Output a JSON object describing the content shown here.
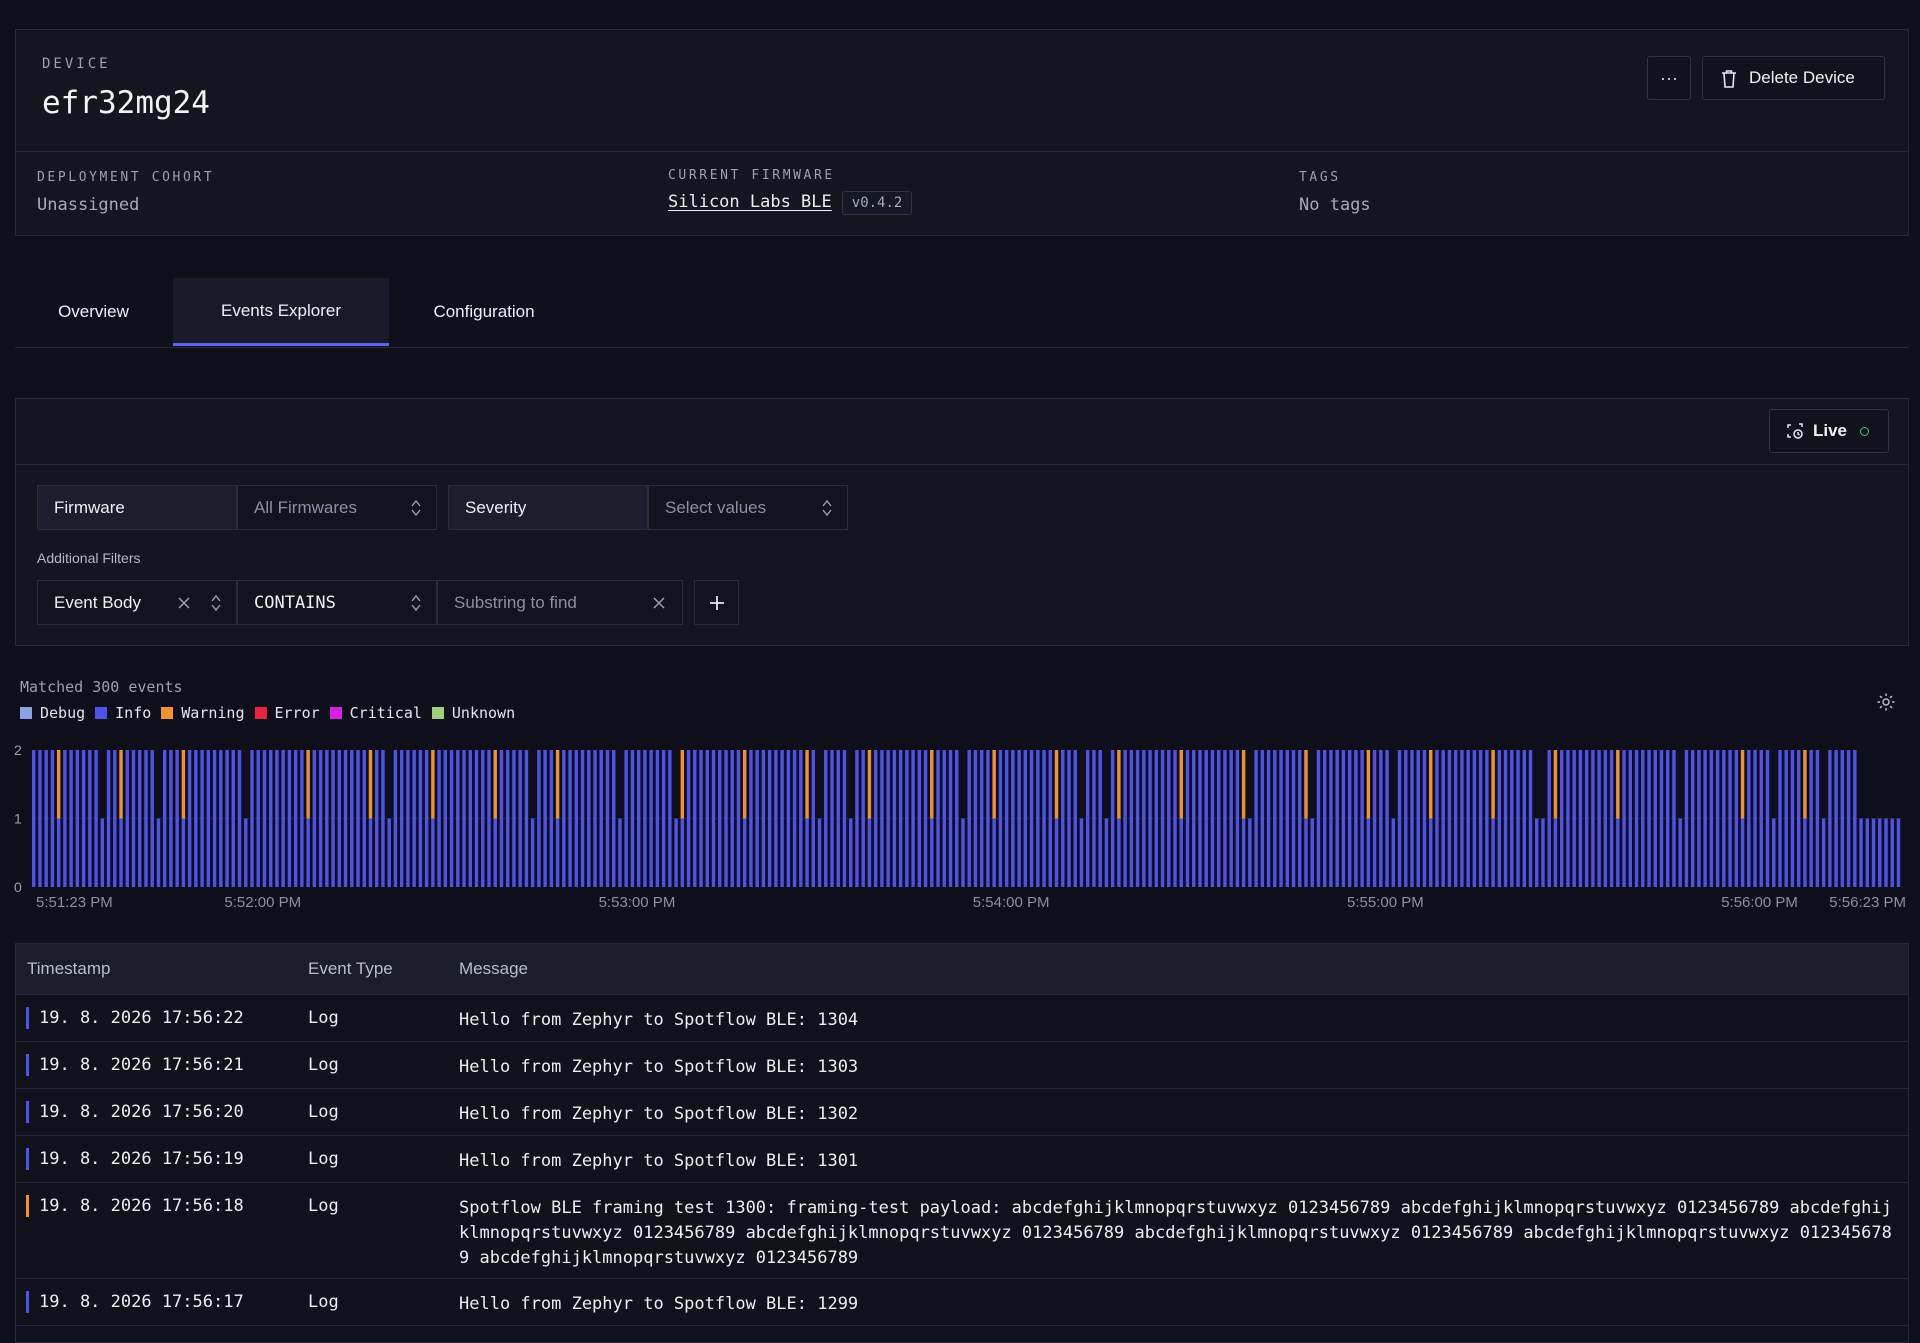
{
  "device": {
    "overline": "DEVICE",
    "name": "efr32mg24",
    "more_label": "···",
    "delete_label": "Delete Device",
    "cohort_label": "DEPLOYMENT COHORT",
    "cohort_value": "Unassigned",
    "firmware_label": "CURRENT FIRMWARE",
    "firmware_value": "Silicon Labs BLE",
    "firmware_version": "v0.4.2",
    "tags_label": "TAGS",
    "tags_value": "No tags"
  },
  "tabs": [
    {
      "label": "Overview",
      "active": false
    },
    {
      "label": "Events Explorer",
      "active": true
    },
    {
      "label": "Configuration",
      "active": false
    }
  ],
  "filters": {
    "live_label": "Live",
    "firmware_label": "Firmware",
    "firmware_value": "All Firmwares",
    "severity_label": "Severity",
    "severity_placeholder": "Select values",
    "additional_label": "Additional Filters",
    "field_value": "Event Body",
    "operator_value": "CONTAINS",
    "substring_placeholder": "Substring to find"
  },
  "summary": {
    "matched_text": "Matched 300 events"
  },
  "legend": [
    {
      "label": "Debug",
      "color": "#8da2e6"
    },
    {
      "label": "Info",
      "color": "#4e52e6"
    },
    {
      "label": "Warning",
      "color": "#f0922e"
    },
    {
      "label": "Error",
      "color": "#e8223f"
    },
    {
      "label": "Critical",
      "color": "#d91ee6"
    },
    {
      "label": "Unknown",
      "color": "#9fcf7d"
    }
  ],
  "chart_data": {
    "type": "bar",
    "stacked": true,
    "x_ticks": [
      "5:51:23 PM",
      "5:52:00 PM",
      "5:53:00 PM",
      "5:54:00 PM",
      "5:55:00 PM",
      "5:56:00 PM",
      "5:56:23 PM"
    ],
    "x_tick_seconds": [
      0,
      37,
      97,
      157,
      217,
      277,
      300
    ],
    "y_ticks": [
      "0",
      "1",
      "2"
    ],
    "ylim": [
      0,
      2
    ],
    "buckets": 300,
    "bar_pattern": "mostly 2 events per second (1 Info + 1 Info or Warning), with occasional seconds of 1 event",
    "series": [
      {
        "name": "Info",
        "color": "#4e52e6"
      },
      {
        "name": "Warning",
        "color": "#f0922e"
      }
    ]
  },
  "table": {
    "headers": [
      "Timestamp",
      "Event Type",
      "Message"
    ],
    "rows": [
      {
        "timestamp": "19. 8. 2026 17:56:22",
        "type": "Log",
        "message": "Hello from Zephyr to Spotflow BLE: 1304",
        "severity_color": "#4e52e6"
      },
      {
        "timestamp": "19. 8. 2026 17:56:21",
        "type": "Log",
        "message": "Hello from Zephyr to Spotflow BLE: 1303",
        "severity_color": "#4e52e6"
      },
      {
        "timestamp": "19. 8. 2026 17:56:20",
        "type": "Log",
        "message": "Hello from Zephyr to Spotflow BLE: 1302",
        "severity_color": "#4e52e6"
      },
      {
        "timestamp": "19. 8. 2026 17:56:19",
        "type": "Log",
        "message": "Hello from Zephyr to Spotflow BLE: 1301",
        "severity_color": "#4e52e6"
      },
      {
        "timestamp": "19. 8. 2026 17:56:18",
        "type": "Log",
        "message": "Spotflow BLE framing test 1300: framing-test payload: abcdefghijklmnopqrstuvwxyz 0123456789 abcdefghijklmnopqrstuvwxyz 0123456789 abcdefghijklmnopqrstuvwxyz 0123456789 abcdefghijklmnopqrstuvwxyz 0123456789 abcdefghijklmnopqrstuvwxyz 0123456789 abcdefghijklmnopqrstuvwxyz 0123456789 abcdefghijklmnopqrstuvwxyz 0123456789",
        "severity_color": "#f0922e"
      },
      {
        "timestamp": "19. 8. 2026 17:56:17",
        "type": "Log",
        "message": "Hello from Zephyr to Spotflow BLE: 1299",
        "severity_color": "#4e52e6"
      }
    ]
  }
}
